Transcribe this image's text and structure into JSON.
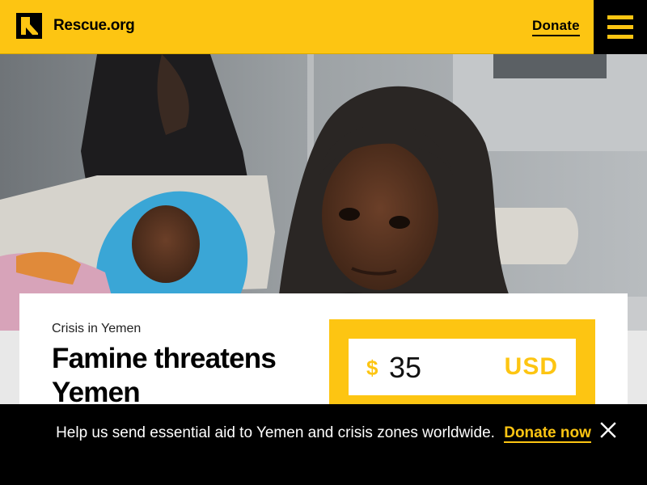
{
  "header": {
    "logo_text": "Rescue.org",
    "donate_label": "Donate",
    "menu_icon": "hamburger-menu-icon"
  },
  "hero": {
    "image": "photo-of-children-in-hospital"
  },
  "card": {
    "eyebrow": "Crisis in Yemen",
    "title": "Famine threatens Yemen",
    "donation": {
      "currency_symbol": "$",
      "amount": "35",
      "currency_code": "USD"
    }
  },
  "banner": {
    "message": "Help us send essential aid to Yemen and crisis zones worldwide.",
    "cta": "Donate now",
    "close_icon": "close-icon"
  },
  "colors": {
    "brand_yellow": "#fdc512",
    "black": "#000000"
  }
}
